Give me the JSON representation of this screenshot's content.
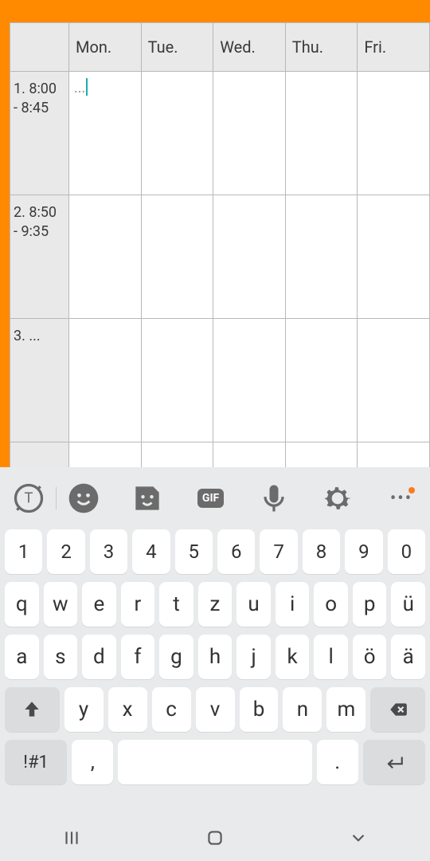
{
  "timetable": {
    "days": [
      "Mon.",
      "Tue.",
      "Wed.",
      "Thu.",
      "Fri."
    ],
    "rows": [
      {
        "label": "1. 8:00 - 8:45"
      },
      {
        "label": "2. 8:50 - 9:35"
      },
      {
        "label": "3. ..."
      },
      {
        "label": ""
      }
    ]
  },
  "edit_cell": {
    "placeholder": "..."
  },
  "keyboard": {
    "toolbar": {
      "gif_label": "GIF"
    },
    "rows": {
      "nums": [
        "1",
        "2",
        "3",
        "4",
        "5",
        "6",
        "7",
        "8",
        "9",
        "0"
      ],
      "r1": [
        "q",
        "w",
        "e",
        "r",
        "t",
        "z",
        "u",
        "i",
        "o",
        "p",
        "ü"
      ],
      "r2": [
        "a",
        "s",
        "d",
        "f",
        "g",
        "h",
        "j",
        "k",
        "l",
        "ö",
        "ä"
      ],
      "r3": [
        "y",
        "x",
        "c",
        "v",
        "b",
        "n",
        "m"
      ],
      "sym_label": "!#1",
      "comma": ",",
      "period": "."
    }
  }
}
